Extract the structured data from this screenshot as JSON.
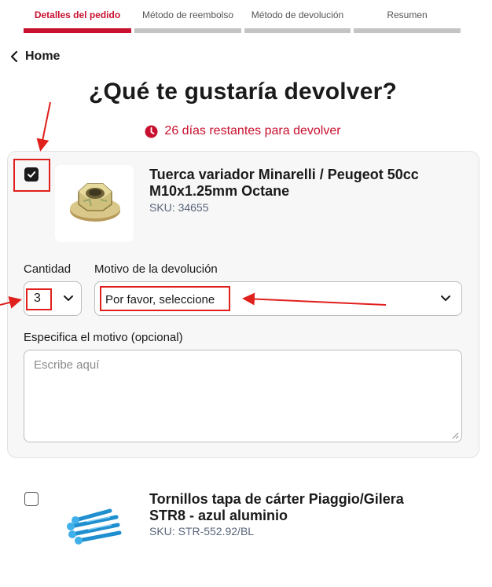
{
  "steps": [
    {
      "label": "Detalles del pedido",
      "active": true
    },
    {
      "label": "Método de reembolso",
      "active": false
    },
    {
      "label": "Método de devolución",
      "active": false
    },
    {
      "label": "Resumen",
      "active": false
    }
  ],
  "nav": {
    "back_label": "Home"
  },
  "page": {
    "title": "¿Qué te gustaría devolver?",
    "days_remaining": "26 días restantes para devolver"
  },
  "items": [
    {
      "name_line1": "Tuerca variador Minarelli / Peugeot 50cc",
      "name_line2": "M10x1.25mm Octane",
      "sku": "SKU: 34655",
      "checked": true
    },
    {
      "name_line1": "Tornillos tapa de cárter Piaggio/Gilera",
      "name_line2": "STR8 - azul aluminio",
      "sku": "SKU: STR-552.92/BL",
      "checked": false
    }
  ],
  "form": {
    "quantity_label": "Cantidad",
    "quantity_value": "3",
    "reason_label": "Motivo de la devolución",
    "reason_value": "Por favor, seleccione",
    "specify_label": "Especifica el motivo (opcional)",
    "specify_placeholder": "Escribe aquí"
  },
  "colors": {
    "accent": "#c8102e",
    "annotation": "#e0201c",
    "step_inactive": "#c4c4c4",
    "card_bg": "#f7f7f7"
  }
}
